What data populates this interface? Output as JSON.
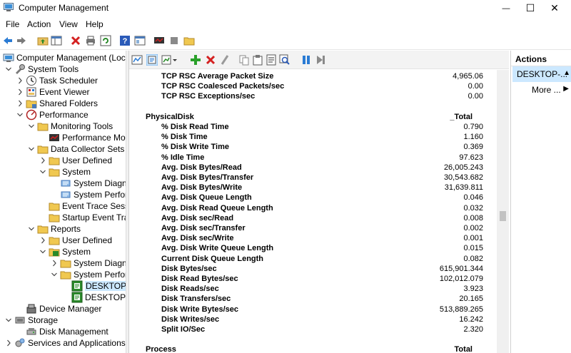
{
  "window": {
    "title": "Computer Management",
    "min_glyph": "—",
    "max_glyph": "☐",
    "close_glyph": "✕"
  },
  "menu": [
    "File",
    "Action",
    "View",
    "Help"
  ],
  "toolbar_icons": [
    "back-arrow-icon",
    "forward-arrow-icon",
    "up-folder-icon",
    "show-hide-tree-icon",
    "delete-icon",
    "print-icon",
    "refresh-icon",
    "help-icon",
    "properties-icon",
    "monitor-icon",
    "stop-icon",
    "folder-icon"
  ],
  "tree": [
    {
      "label": "Computer Management (Local)",
      "indent": 0,
      "twisty": "",
      "icon": "computer"
    },
    {
      "label": "System Tools",
      "indent": 1,
      "twisty": "expanded",
      "icon": "tools"
    },
    {
      "label": "Task Scheduler",
      "indent": 2,
      "twisty": "collapsed",
      "icon": "clock"
    },
    {
      "label": "Event Viewer",
      "indent": 2,
      "twisty": "collapsed",
      "icon": "event"
    },
    {
      "label": "Shared Folders",
      "indent": 2,
      "twisty": "collapsed",
      "icon": "share"
    },
    {
      "label": "Performance",
      "indent": 2,
      "twisty": "expanded",
      "icon": "perf"
    },
    {
      "label": "Monitoring Tools",
      "indent": 3,
      "twisty": "expanded",
      "icon": "folder"
    },
    {
      "label": "Performance Mon",
      "indent": 4,
      "twisty": "",
      "icon": "monitor"
    },
    {
      "label": "Data Collector Sets",
      "indent": 3,
      "twisty": "expanded",
      "icon": "folder"
    },
    {
      "label": "User Defined",
      "indent": 4,
      "twisty": "collapsed",
      "icon": "folder"
    },
    {
      "label": "System",
      "indent": 4,
      "twisty": "expanded",
      "icon": "folder"
    },
    {
      "label": "System Diagnc",
      "indent": 5,
      "twisty": "",
      "icon": "dcs"
    },
    {
      "label": "System Perforr",
      "indent": 5,
      "twisty": "",
      "icon": "dcs"
    },
    {
      "label": "Event Trace Session",
      "indent": 4,
      "twisty": "",
      "icon": "folder"
    },
    {
      "label": "Startup Event Trace",
      "indent": 4,
      "twisty": "",
      "icon": "folder"
    },
    {
      "label": "Reports",
      "indent": 3,
      "twisty": "expanded",
      "icon": "folder"
    },
    {
      "label": "User Defined",
      "indent": 4,
      "twisty": "collapsed",
      "icon": "folder"
    },
    {
      "label": "System",
      "indent": 4,
      "twisty": "expanded",
      "icon": "folder-green"
    },
    {
      "label": "System Diagnc",
      "indent": 5,
      "twisty": "collapsed",
      "icon": "folder"
    },
    {
      "label": "System Perforr",
      "indent": 5,
      "twisty": "expanded",
      "icon": "folder"
    },
    {
      "label": "DESKTOP-E",
      "indent": 6,
      "twisty": "",
      "icon": "report",
      "selected": true
    },
    {
      "label": "DESKTOP-E",
      "indent": 6,
      "twisty": "",
      "icon": "report"
    },
    {
      "label": "Device Manager",
      "indent": 2,
      "twisty": "",
      "icon": "device"
    },
    {
      "label": "Storage",
      "indent": 1,
      "twisty": "expanded",
      "icon": "storage"
    },
    {
      "label": "Disk Management",
      "indent": 2,
      "twisty": "",
      "icon": "disk"
    },
    {
      "label": "Services and Applications",
      "indent": 1,
      "twisty": "collapsed",
      "icon": "services"
    }
  ],
  "center_toolbar_icons": [
    "view-graph-icon",
    "view-report-icon",
    "change-graph-icon",
    "add-counter-icon",
    "delete-counter-icon",
    "highlight-icon",
    "copy-icon",
    "paste-icon",
    "properties-icon",
    "zoom-icon",
    "pause-icon",
    "next-icon"
  ],
  "report": [
    {
      "label": "TCP RSC Average Packet Size",
      "value": "4,965.06",
      "type": "counter"
    },
    {
      "label": "TCP RSC Coalesced Packets/sec",
      "value": "0.00",
      "type": "counter"
    },
    {
      "label": "TCP RSC Exceptions/sec",
      "value": "0.00",
      "type": "counter"
    },
    {
      "label": "",
      "value": "",
      "type": "blank"
    },
    {
      "label": "PhysicalDisk",
      "value": "_Total",
      "type": "object"
    },
    {
      "label": "% Disk Read Time",
      "value": "0.790",
      "type": "counter"
    },
    {
      "label": "% Disk Time",
      "value": "1.160",
      "type": "counter"
    },
    {
      "label": "% Disk Write Time",
      "value": "0.369",
      "type": "counter"
    },
    {
      "label": "% Idle Time",
      "value": "97.623",
      "type": "counter"
    },
    {
      "label": "Avg. Disk Bytes/Read",
      "value": "26,005.243",
      "type": "counter"
    },
    {
      "label": "Avg. Disk Bytes/Transfer",
      "value": "30,543.682",
      "type": "counter"
    },
    {
      "label": "Avg. Disk Bytes/Write",
      "value": "31,639.811",
      "type": "counter"
    },
    {
      "label": "Avg. Disk Queue Length",
      "value": "0.046",
      "type": "counter"
    },
    {
      "label": "Avg. Disk Read Queue Length",
      "value": "0.032",
      "type": "counter"
    },
    {
      "label": "Avg. Disk sec/Read",
      "value": "0.008",
      "type": "counter"
    },
    {
      "label": "Avg. Disk sec/Transfer",
      "value": "0.002",
      "type": "counter"
    },
    {
      "label": "Avg. Disk sec/Write",
      "value": "0.001",
      "type": "counter"
    },
    {
      "label": "Avg. Disk Write Queue Length",
      "value": "0.015",
      "type": "counter"
    },
    {
      "label": "Current Disk Queue Length",
      "value": "0.082",
      "type": "counter"
    },
    {
      "label": "Disk Bytes/sec",
      "value": "615,901.344",
      "type": "counter"
    },
    {
      "label": "Disk Read Bytes/sec",
      "value": "102,012.079",
      "type": "counter"
    },
    {
      "label": "Disk Reads/sec",
      "value": "3.923",
      "type": "counter"
    },
    {
      "label": "Disk Transfers/sec",
      "value": "20.165",
      "type": "counter"
    },
    {
      "label": "Disk Write Bytes/sec",
      "value": "513,889.265",
      "type": "counter"
    },
    {
      "label": "Disk Writes/sec",
      "value": "16.242",
      "type": "counter"
    },
    {
      "label": "Split IO/Sec",
      "value": "2.320",
      "type": "counter"
    },
    {
      "label": "",
      "value": "",
      "type": "blank"
    },
    {
      "label": "Process",
      "value": "Total",
      "type": "object"
    }
  ],
  "actions": {
    "header": "Actions",
    "selected": "DESKTOP-...",
    "more": "More ...",
    "collapse_glyph": "▲",
    "more_glyph": "▶"
  }
}
